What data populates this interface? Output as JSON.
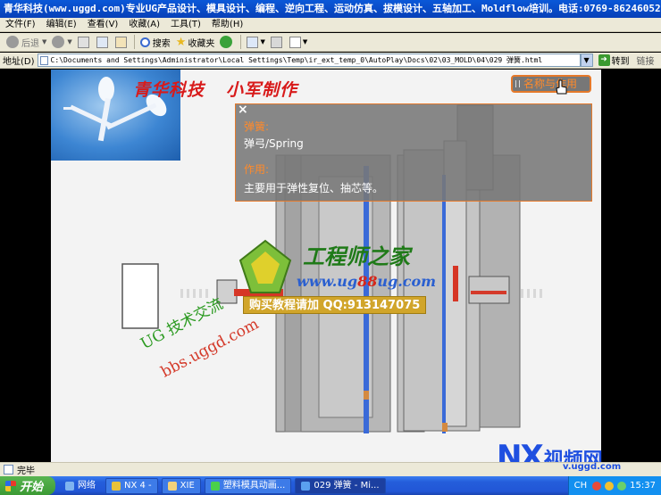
{
  "window": {
    "title": "青华科技(www.uggd.com)专业UG产品设计、模具设计、编程、逆向工程、运动仿真、拔模设计、五轴加工、Moldflow培训。电话:0769-86246052"
  },
  "menu": [
    "文件(F)",
    "编辑(E)",
    "查看(V)",
    "收藏(A)",
    "工具(T)",
    "帮助(H)"
  ],
  "toolbar": {
    "back_label": "后退",
    "search_label": "搜索",
    "favorites_label": "收藏夹"
  },
  "address": {
    "label": "地址(D)",
    "value": "C:\\Documents and Settings\\Administrator\\Local Settings\\Temp\\ir_ext_temp_0\\AutoPlay\\Docs\\02\\03_MOLD\\04\\029 弹簧.html",
    "go_label": "转到",
    "links_label": "链接"
  },
  "page": {
    "brand_left": "青华科技",
    "brand_right": "小军制作",
    "name_button": "名称与作用",
    "popup": {
      "close": "×",
      "name_heading": "弹簧:",
      "name_value": "弹弓/Spring",
      "func_heading": "作用:",
      "func_value": "主要用于弹性复位、抽芯等。"
    },
    "watermark": {
      "title": "工程师之家",
      "site_a": "www.ug",
      "site_b": "88",
      "site_c": "ug.com",
      "buy": "购买教程请加 QQ:913147075",
      "diag1": "UG 技术交流",
      "diag2": "bbs.uggd.com"
    }
  },
  "nx_logo": {
    "nx": "NX",
    "cn": "视频网",
    "url": "v.uggd.com"
  },
  "status": {
    "text": "完毕"
  },
  "taskbar": {
    "start": "开始",
    "items": [
      {
        "label": "网络"
      },
      {
        "label": "NX 4 -"
      },
      {
        "label": "XIE"
      },
      {
        "label": "塑料模具动画..."
      },
      {
        "label": "029 弹簧 - Mi..."
      }
    ],
    "tray": {
      "lang": "CH",
      "time": "15:37"
    }
  },
  "colors": {
    "accent_orange": "#e5792a",
    "brand_red": "#d81a1a",
    "xp_blue": "#245edb"
  }
}
